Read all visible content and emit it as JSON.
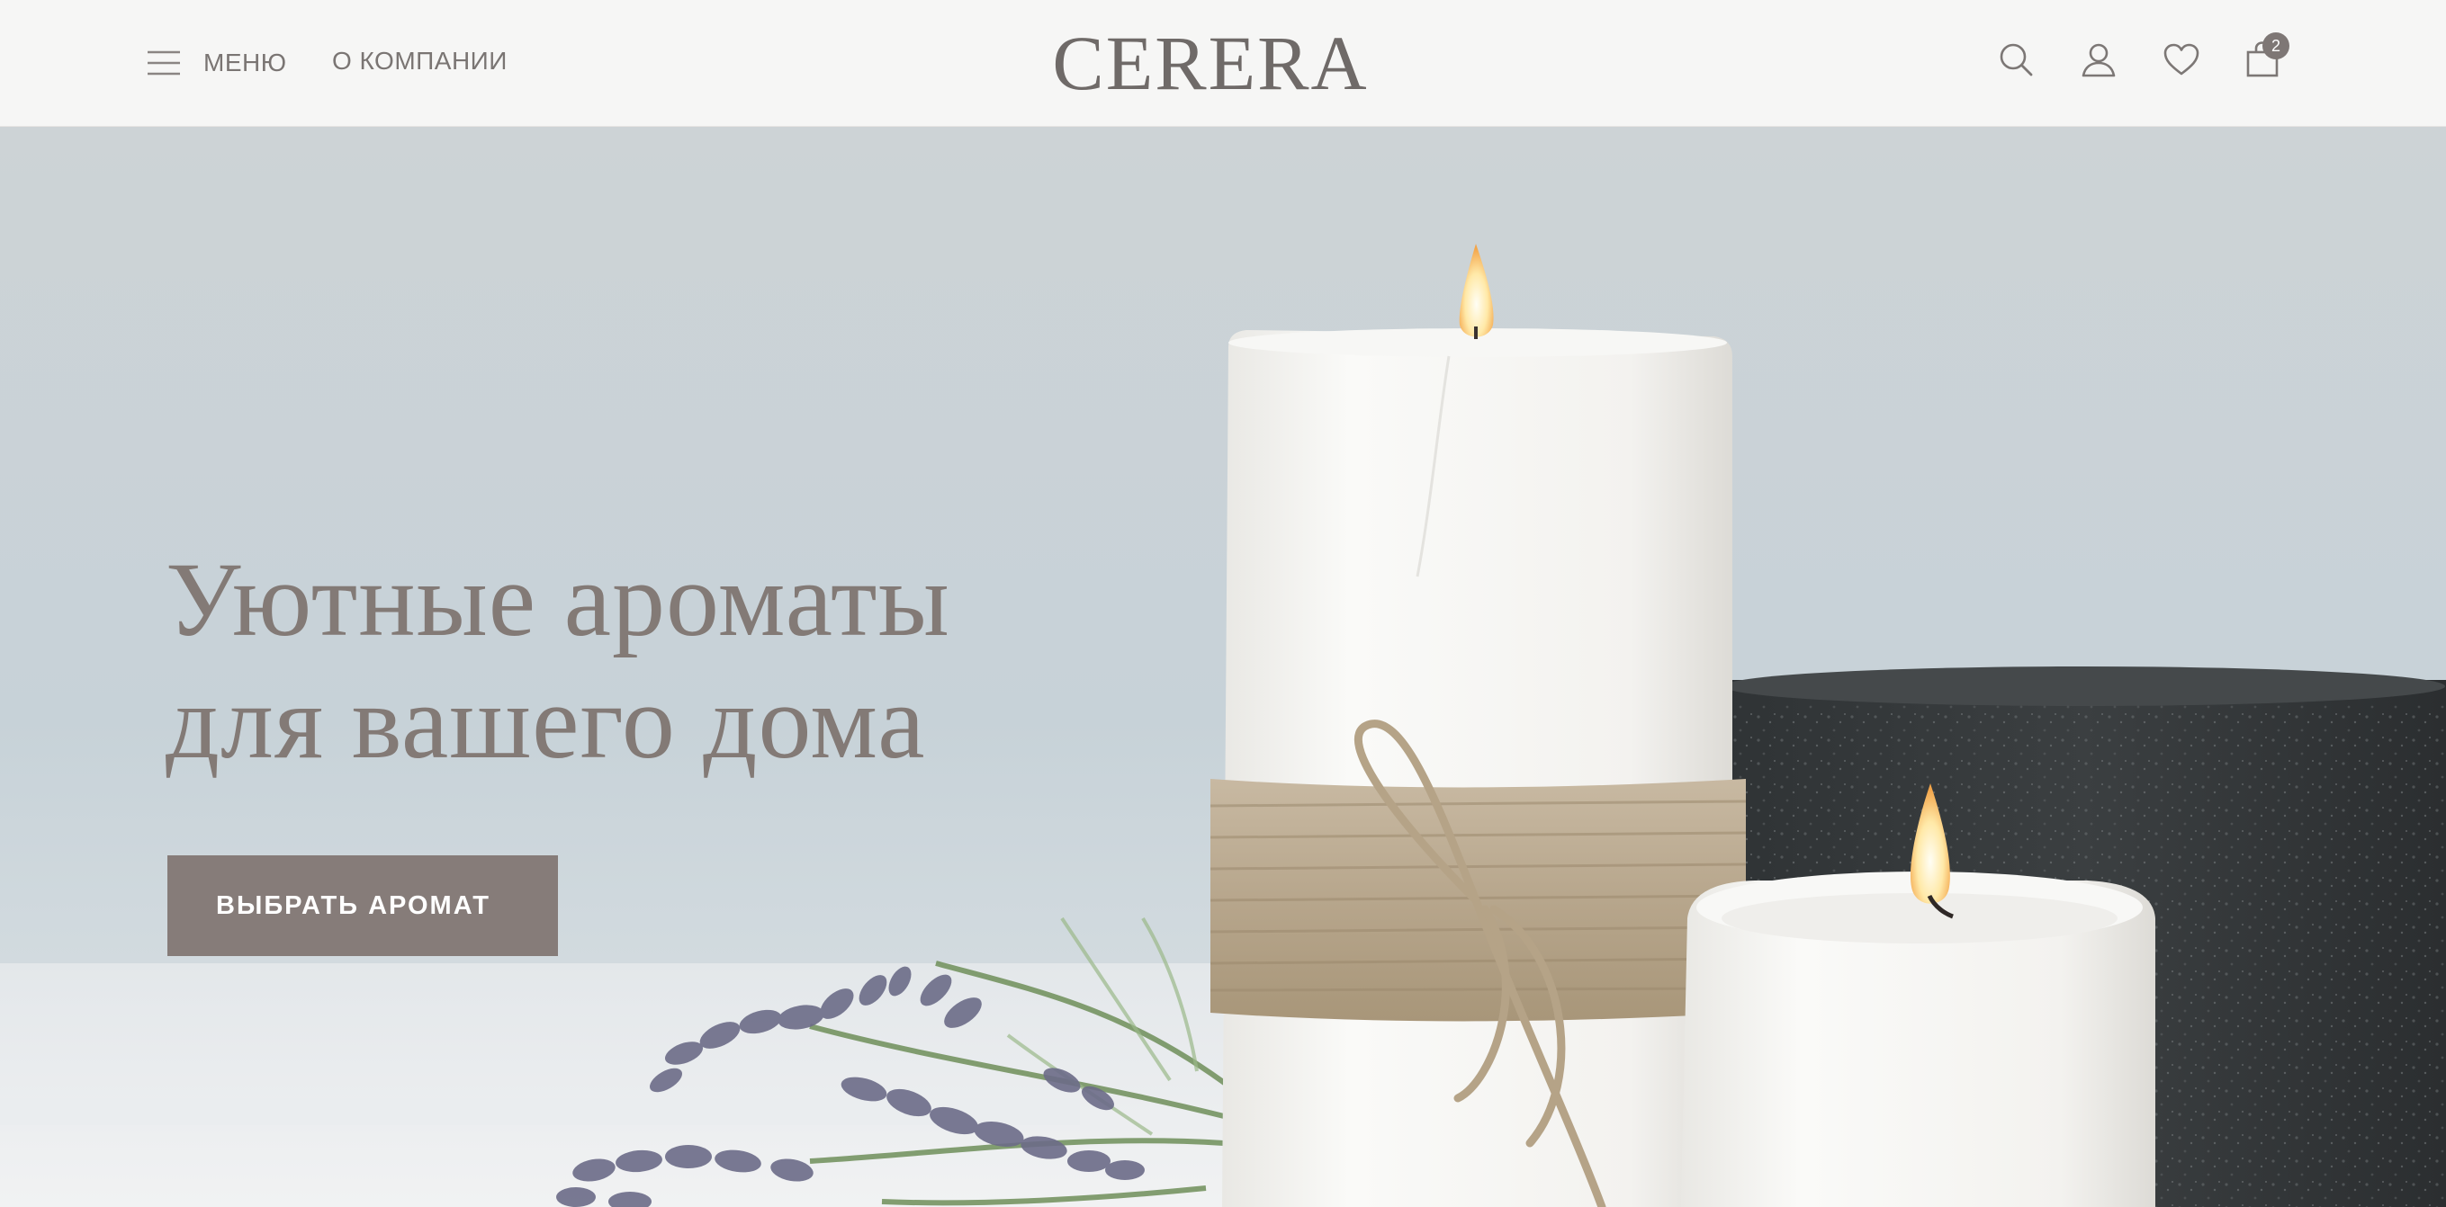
{
  "header": {
    "menu_label": "МЕНЮ",
    "about_label": "О КОМПАНИИ",
    "logo": "CERERA",
    "cart_count": "2",
    "icons": [
      "menu-icon",
      "search-icon",
      "user-icon",
      "heart-icon",
      "bag-icon"
    ]
  },
  "hero": {
    "title_line1": "Уютные ароматы",
    "title_line2": "для вашего дома",
    "cta_label": "ВЫБРАТЬ АРОМАТ"
  },
  "colors": {
    "header_bg": "#f6f6f5",
    "text_muted": "#7a7573",
    "title": "#837a76",
    "button_bg": "#867c79",
    "button_text": "#ffffff"
  }
}
